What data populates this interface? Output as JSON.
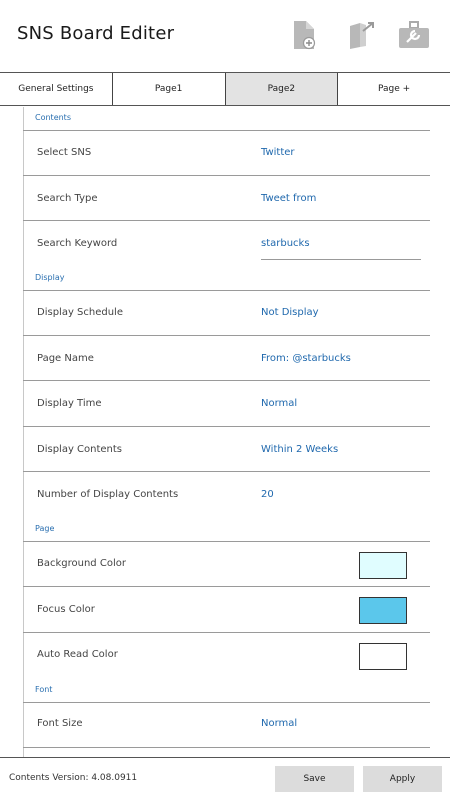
{
  "header": {
    "title": "SNS Board Editer",
    "icons": [
      "add-page-icon",
      "book-export-icon",
      "toolbox-icon"
    ]
  },
  "tabs": [
    {
      "label": "General Settings",
      "active": false
    },
    {
      "label": "Page1",
      "active": false
    },
    {
      "label": "Page2",
      "active": true
    },
    {
      "label": "Page +",
      "active": false
    }
  ],
  "sections": {
    "contents": {
      "label": "Contents",
      "select_sns": {
        "label": "Select SNS",
        "value": "Twitter"
      },
      "search_type": {
        "label": "Search Type",
        "value": "Tweet from"
      },
      "search_keyword": {
        "label": "Search Keyword",
        "value": "starbucks"
      }
    },
    "display": {
      "label": "Display",
      "display_schedule": {
        "label": "Display Schedule",
        "value": "Not Display"
      },
      "page_name": {
        "label": "Page Name",
        "value": "From: @starbucks"
      },
      "display_time": {
        "label": "Display Time",
        "value": "Normal"
      },
      "display_contents": {
        "label": "Display Contents",
        "value": "Within 2 Weeks"
      },
      "number_of_display_contents": {
        "label": "Number of Display Contents",
        "value": "20"
      }
    },
    "page": {
      "label": "Page",
      "background_color": {
        "label": "Background Color",
        "color": "#e0fdff"
      },
      "focus_color": {
        "label": "Focus Color",
        "color": "#5bc7eb"
      },
      "auto_read_color": {
        "label": "Auto Read Color",
        "color": "#ffffff"
      }
    },
    "font": {
      "label": "Font",
      "font_size": {
        "label": "Font Size",
        "value": "Normal"
      }
    }
  },
  "footer": {
    "version": "Contents Version: 4.08.0911",
    "save_label": "Save",
    "apply_label": "Apply"
  },
  "colors": {
    "accent": "#1f68ad",
    "active_tab": "#e3e3e3",
    "button": "#dcdcdc"
  }
}
